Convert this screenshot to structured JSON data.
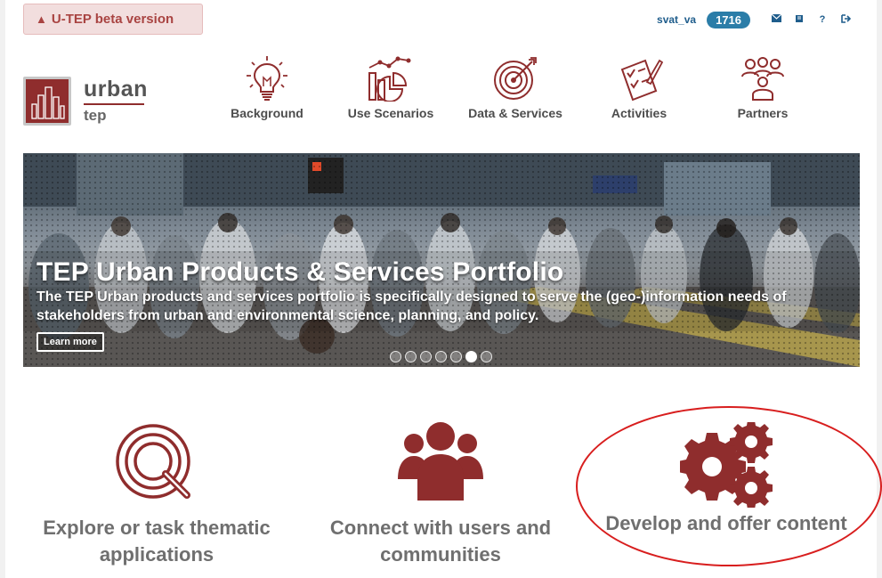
{
  "beta_notice": {
    "icon": "warning-icon",
    "label": "U-TEP beta version"
  },
  "topbar": {
    "username": "svat_va",
    "badge": "1716",
    "icons": [
      "envelope-icon",
      "book-icon",
      "question-icon",
      "sign-out-icon"
    ]
  },
  "logo": {
    "word1": "urban",
    "word2": "tep"
  },
  "nav": {
    "items": [
      {
        "label": "Background",
        "icon": "lightbulb-icon"
      },
      {
        "label": "Use Scenarios",
        "icon": "chart-icon"
      },
      {
        "label": "Data & Services",
        "icon": "target-icon"
      },
      {
        "label": "Activities",
        "icon": "checklist-icon"
      },
      {
        "label": "Partners",
        "icon": "people-icon"
      }
    ]
  },
  "banner": {
    "title": "TEP Urban Products & Services Portfolio",
    "text": "The TEP Urban products and services portfolio is specifically designed to serve the (geo-)information needs of stakeholders from urban and environmental science, planning, and policy.",
    "button": "Learn more",
    "slide_count": 7,
    "active_slide": 6
  },
  "features": [
    {
      "label": "Explore or task thematic applications",
      "icon": "magnifier-circle-icon"
    },
    {
      "label": "Connect with users and communities",
      "icon": "users-icon"
    },
    {
      "label": "Develop and offer content",
      "icon": "gears-icon"
    }
  ],
  "colors": {
    "brand": "#8f2d2d",
    "link": "#1f5d8c",
    "badge": "#2b7da8",
    "highlight": "#d81e1e"
  }
}
